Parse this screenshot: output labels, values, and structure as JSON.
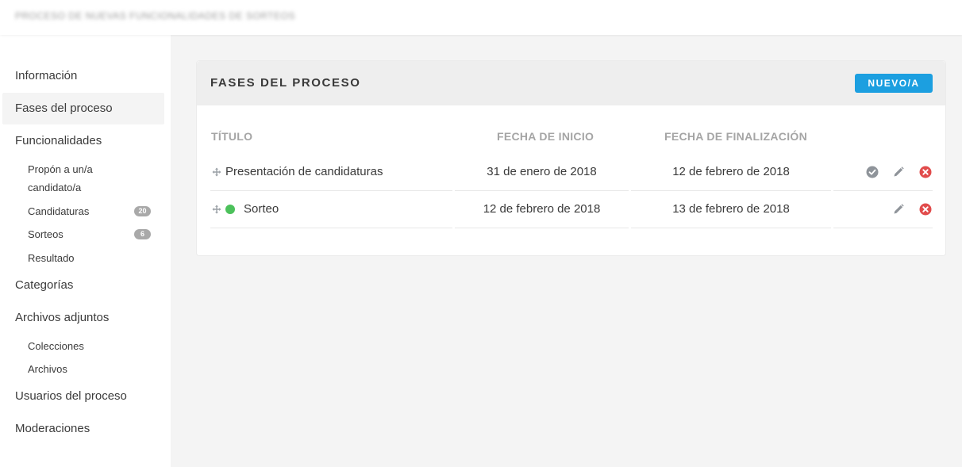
{
  "header": {
    "title": "PROCESO DE NUEVAS FUNCIONALIDADES DE SORTEOS"
  },
  "sidebar": {
    "items": [
      {
        "label": "Información"
      },
      {
        "label": "Fases del proceso",
        "active": true
      },
      {
        "label": "Funcionalidades"
      },
      {
        "label": "Categorías"
      },
      {
        "label": "Archivos adjuntos"
      },
      {
        "label": "Usuarios del proceso"
      },
      {
        "label": "Moderaciones"
      }
    ],
    "funcionalidades_sub": [
      {
        "label_line1": "Propón a un/a",
        "label_line2": "candidato/a"
      },
      {
        "label": "Candidaturas",
        "badge": "20"
      },
      {
        "label": "Sorteos",
        "badge": "6"
      },
      {
        "label": "Resultado"
      }
    ],
    "adjuntos_sub": [
      {
        "label": "Colecciones"
      },
      {
        "label": "Archivos"
      }
    ]
  },
  "card": {
    "title": "FASES DEL PROCESO",
    "new_button": "NUEVO/A",
    "columns": [
      "TÍTULO",
      "FECHA DE INICIO",
      "FECHA DE FINALIZACIÓN"
    ],
    "rows": [
      {
        "title": "Presentación de candidaturas",
        "start": "31 de enero de 2018",
        "end": "12 de febrero de 2018",
        "active": false,
        "actions": [
          "activate-icon",
          "pencil-icon",
          "delete-icon"
        ]
      },
      {
        "title": "Sorteo",
        "start": "12 de febrero de 2018",
        "end": "13 de febrero de 2018",
        "active": true,
        "actions": [
          "pencil-icon",
          "delete-icon"
        ]
      }
    ]
  },
  "colors": {
    "accent": "#1c9fe0",
    "active_dot": "#4cc15b",
    "delete": "#e14c4c",
    "icon_gray": "#8f949a",
    "badge": "#a9a9a9",
    "content_bg": "#f4f4f4"
  }
}
